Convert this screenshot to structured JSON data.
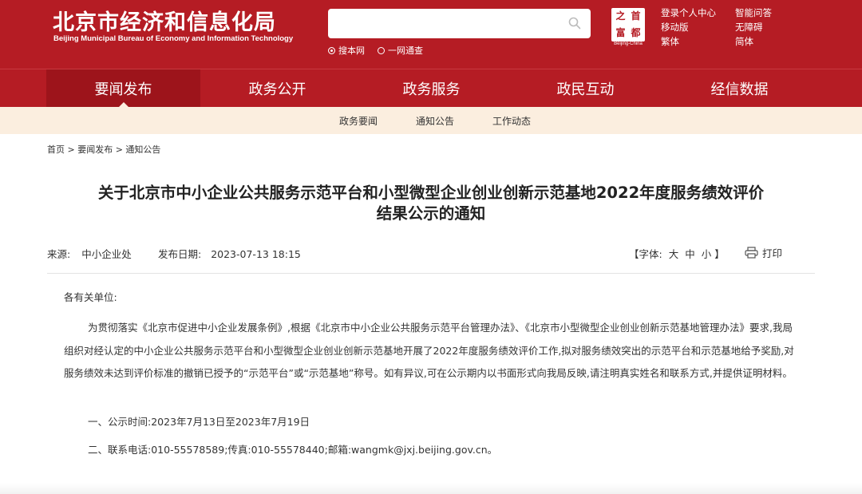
{
  "header": {
    "logo_cn": "北京市经济和信息化局",
    "logo_en": "Beijing Municipal Bureau of Economy and Information Technology",
    "search": {
      "placeholder": "",
      "options": [
        "搜本网",
        "一网通查"
      ]
    },
    "seal_chars": [
      "之",
      "首",
      "富",
      "都"
    ],
    "seal_en": "Beijing-China",
    "links_left": [
      "登录个人中心",
      "移动版",
      "繁体"
    ],
    "links_right": [
      "智能问答",
      "无障碍",
      "简体"
    ]
  },
  "mainnav": {
    "items": [
      "要闻发布",
      "政务公开",
      "政务服务",
      "政民互动",
      "经信数据"
    ],
    "active_index": 0
  },
  "subnav": {
    "items": [
      "政务要闻",
      "通知公告",
      "工作动态"
    ]
  },
  "breadcrumb": "首页 > 要闻发布 > 通知公告",
  "article": {
    "title_line1": "关于北京市中小企业公共服务示范平台和小型微型企业创业创新示范基地2022年度服务绩效评价",
    "title_line2": "结果公示的通知",
    "source_label": "来源:",
    "source_value": "中小企业处",
    "date_label": "发布日期:",
    "date_value": "2023-07-13 18:15",
    "font_label": "【字体:",
    "font_sizes": [
      "大",
      "中",
      "小"
    ],
    "font_close": "】",
    "print_label": "打印",
    "salutation": "各有关单位:",
    "paragraph": "为贯彻落实《北京市促进中小企业发展条例》,根据《北京市中小企业公共服务示范平台管理办法》、《北京市小型微型企业创业创新示范基地管理办法》要求,我局组织对经认定的中小企业公共服务示范平台和小型微型企业创业创新示范基地开展了2022年度服务绩效评价工作,拟对服务绩效突出的示范平台和示范基地给予奖励,对服务绩效未达到评价标准的撤销已授予的“示范平台”或“示范基地”称号。如有异议,可在公示期内以书面形式向我局反映,请注明真实姓名和联系方式,并提供证明材料。",
    "item1": "一、公示时间:2023年7月13日至2023年7月19日",
    "item2": "二、联系电话:010-55578589;传真:010-55578440;邮箱:wangmk@jxj.beijing.gov.cn。"
  },
  "colors": {
    "brand_red": "#b51c24",
    "active_red": "#9d141b",
    "subnav_bg": "#fbeedf"
  }
}
